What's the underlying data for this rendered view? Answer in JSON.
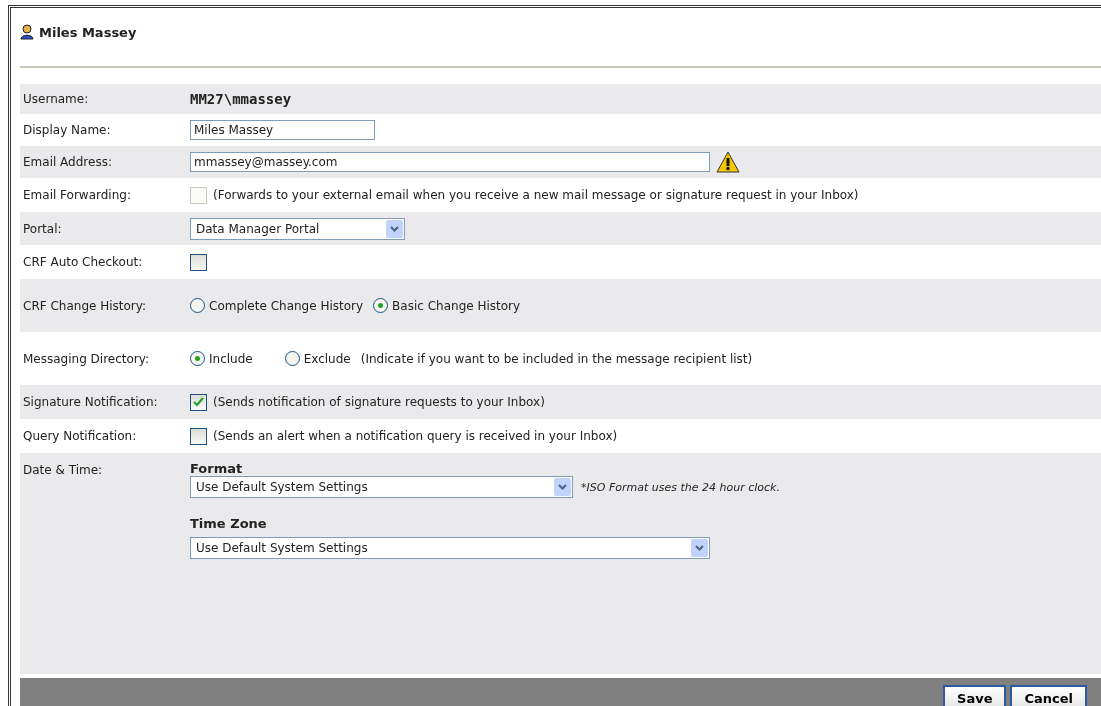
{
  "title": "Miles Massey",
  "rows": [
    {
      "kind": "text",
      "label": "Username:",
      "value": "MM27\\mmassey"
    },
    {
      "kind": "input",
      "label": "Display Name:",
      "value": "Miles Massey"
    },
    {
      "kind": "input",
      "label": "Email Address:",
      "value": "mmassey@massey.com",
      "warning": true
    },
    {
      "kind": "checkbox",
      "label": "Email Forwarding:",
      "checked": false,
      "disabled": true,
      "note": "(Forwards to your external email when you receive a new mail message or signature request in your Inbox)"
    },
    {
      "kind": "select",
      "label": "Portal:",
      "value": "Data Manager Portal"
    },
    {
      "kind": "checkbox",
      "label": "CRF Auto Checkout:",
      "checked": false,
      "disabled": false
    },
    {
      "kind": "radio",
      "label": "CRF Change History:",
      "options": [
        {
          "label": "Complete Change History",
          "selected": false
        },
        {
          "label": "Basic Change History",
          "selected": true
        }
      ]
    },
    {
      "kind": "radio",
      "label": "Messaging Directory:",
      "options": [
        {
          "label": "Include",
          "selected": true
        },
        {
          "label": "Exclude",
          "selected": false
        }
      ],
      "note": "(Indicate if you want to be included in the message recipient list)"
    },
    {
      "kind": "checkbox",
      "label": "Signature Notification:",
      "checked": true,
      "disabled": false,
      "note": "(Sends notification of signature requests to your Inbox)"
    },
    {
      "kind": "checkbox",
      "label": "Query Notification:",
      "checked": false,
      "disabled": false,
      "note": "(Sends an alert when a notification query is received in your Inbox)"
    },
    {
      "kind": "datetime",
      "label": "Date & Time:",
      "format": {
        "heading": "Format",
        "value": "Use Default System Settings",
        "note": "*ISO Format uses the 24 hour clock."
      },
      "time_zone": {
        "heading": "Time Zone",
        "value": "Use Default System Settings"
      }
    }
  ],
  "buttons": [
    "Save",
    "Cancel"
  ]
}
